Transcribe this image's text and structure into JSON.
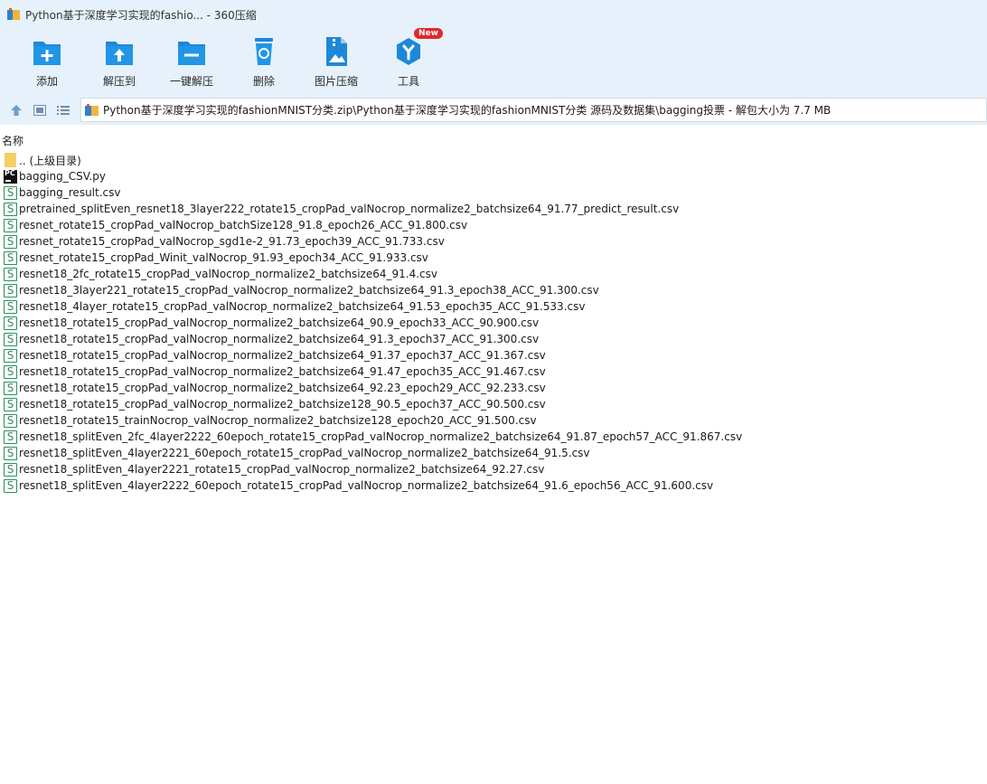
{
  "window": {
    "title": "Python基于深度学习实现的fashio... - 360压缩"
  },
  "toolbar": {
    "items": [
      {
        "label": "添加",
        "icon": "add-icon"
      },
      {
        "label": "解压到",
        "icon": "extract-to-icon"
      },
      {
        "label": "一键解压",
        "icon": "one-click-extract-icon"
      },
      {
        "label": "删除",
        "icon": "delete-icon"
      },
      {
        "label": "图片压缩",
        "icon": "image-compress-icon"
      },
      {
        "label": "工具",
        "icon": "tools-icon",
        "badge": "New"
      }
    ]
  },
  "address": {
    "path": "Python基于深度学习实现的fashionMNIST分类.zip\\Python基于深度学习实现的fashionMNIST分类 源码及数据集\\bagging投票 - 解包大小为 7.7 MB"
  },
  "columns": {
    "name": "名称"
  },
  "files": [
    {
      "type": "folder",
      "name": ".. (上级目录)"
    },
    {
      "type": "py",
      "name": "bagging_CSV.py"
    },
    {
      "type": "csv",
      "name": "bagging_result.csv"
    },
    {
      "type": "csv",
      "name": "pretrained_splitEven_resnet18_3layer222_rotate15_cropPad_valNocrop_normalize2_batchsize64_91.77_predict_result.csv"
    },
    {
      "type": "csv",
      "name": "resnet_rotate15_cropPad_valNocrop_batchSize128_91.8_epoch26_ACC_91.800.csv"
    },
    {
      "type": "csv",
      "name": "resnet_rotate15_cropPad_valNocrop_sgd1e-2_91.73_epoch39_ACC_91.733.csv"
    },
    {
      "type": "csv",
      "name": "resnet_rotate15_cropPad_Winit_valNocrop_91.93_epoch34_ACC_91.933.csv"
    },
    {
      "type": "csv",
      "name": "resnet18_2fc_rotate15_cropPad_valNocrop_normalize2_batchsize64_91.4.csv"
    },
    {
      "type": "csv",
      "name": "resnet18_3layer221_rotate15_cropPad_valNocrop_normalize2_batchsize64_91.3_epoch38_ACC_91.300.csv"
    },
    {
      "type": "csv",
      "name": "resnet18_4layer_rotate15_cropPad_valNocrop_normalize2_batchsize64_91.53_epoch35_ACC_91.533.csv"
    },
    {
      "type": "csv",
      "name": "resnet18_rotate15_cropPad_valNocrop_normalize2_batchsize64_90.9_epoch33_ACC_90.900.csv"
    },
    {
      "type": "csv",
      "name": "resnet18_rotate15_cropPad_valNocrop_normalize2_batchsize64_91.3_epoch37_ACC_91.300.csv"
    },
    {
      "type": "csv",
      "name": "resnet18_rotate15_cropPad_valNocrop_normalize2_batchsize64_91.37_epoch37_ACC_91.367.csv"
    },
    {
      "type": "csv",
      "name": "resnet18_rotate15_cropPad_valNocrop_normalize2_batchsize64_91.47_epoch35_ACC_91.467.csv"
    },
    {
      "type": "csv",
      "name": "resnet18_rotate15_cropPad_valNocrop_normalize2_batchsize64_92.23_epoch29_ACC_92.233.csv"
    },
    {
      "type": "csv",
      "name": "resnet18_rotate15_cropPad_valNocrop_normalize2_batchsize128_90.5_epoch37_ACC_90.500.csv"
    },
    {
      "type": "csv",
      "name": "resnet18_rotate15_trainNocrop_valNocrop_normalize2_batchsize128_epoch20_ACC_91.500.csv"
    },
    {
      "type": "csv",
      "name": "resnet18_splitEven_2fc_4layer2222_60epoch_rotate15_cropPad_valNocrop_normalize2_batchsize64_91.87_epoch57_ACC_91.867.csv"
    },
    {
      "type": "csv",
      "name": "resnet18_splitEven_4layer2221_60epoch_rotate15_cropPad_valNocrop_normalize2_batchsize64_91.5.csv"
    },
    {
      "type": "csv",
      "name": "resnet18_splitEven_4layer2221_rotate15_cropPad_valNocrop_normalize2_batchsize64_92.27.csv"
    },
    {
      "type": "csv",
      "name": "resnet18_splitEven_4layer2222_60epoch_rotate15_cropPad_valNocrop_normalize2_batchsize64_91.6_epoch56_ACC_91.600.csv"
    }
  ],
  "colors": {
    "chrome": "#e6f1fb",
    "icon_blue": "#1e88d8",
    "csv_green": "#2e8f57",
    "folder_yellow": "#f4ce66"
  }
}
